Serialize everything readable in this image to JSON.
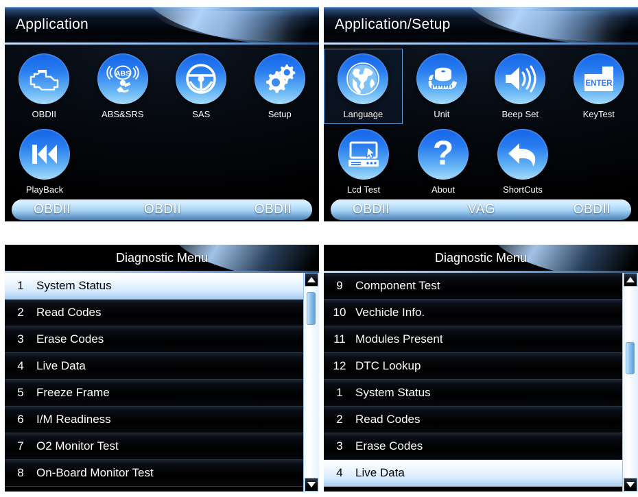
{
  "panels": {
    "application": {
      "title": "Application",
      "items": [
        {
          "label": "OBDII",
          "icon": "engine-icon"
        },
        {
          "label": "ABS&SRS",
          "icon": "abs-srs-icon"
        },
        {
          "label": "SAS",
          "icon": "steering-wheel-icon"
        },
        {
          "label": "Setup",
          "icon": "gears-icon"
        },
        {
          "label": "PlayBack",
          "icon": "rewind-icon"
        }
      ],
      "softkeys": [
        "OBDII",
        "OBDII",
        "OBDII"
      ]
    },
    "setup": {
      "title": "Application/Setup",
      "items": [
        {
          "label": "Language",
          "icon": "globe-icon",
          "selected": true
        },
        {
          "label": "Unit",
          "icon": "tape-measure-icon",
          "selected": false
        },
        {
          "label": "Beep Set",
          "icon": "speaker-icon",
          "selected": false
        },
        {
          "label": "KeyTest",
          "icon": "enter-key-icon",
          "selected": false
        },
        {
          "label": "Lcd Test",
          "icon": "monitor-cursor-icon",
          "selected": false
        },
        {
          "label": "About",
          "icon": "question-mark-icon",
          "selected": false
        },
        {
          "label": "ShortCuts",
          "icon": "back-arrow-icon",
          "selected": false
        }
      ],
      "softkeys": [
        "OBDII",
        "VAG",
        "OBDII"
      ]
    },
    "diagnostic_page1": {
      "title": "Diagnostic Menu",
      "rows": [
        {
          "num": "1",
          "label": "System  Status",
          "highlighted": true
        },
        {
          "num": "2",
          "label": "Read Codes",
          "highlighted": false
        },
        {
          "num": "3",
          "label": "Erase Codes",
          "highlighted": false
        },
        {
          "num": "4",
          "label": "Live Data",
          "highlighted": false
        },
        {
          "num": "5",
          "label": "Freeze Frame",
          "highlighted": false
        },
        {
          "num": "6",
          "label": "I/M Readiness",
          "highlighted": false
        },
        {
          "num": "7",
          "label": "O2 Monitor Test",
          "highlighted": false
        },
        {
          "num": "8",
          "label": "On-Board Monitor Test",
          "highlighted": false
        }
      ],
      "scroll": {
        "thumb_top_pct": 3,
        "thumb_height_pct": 17
      }
    },
    "diagnostic_page2": {
      "title": "Diagnostic Menu",
      "rows": [
        {
          "num": "9",
          "label": "Component Test",
          "highlighted": false
        },
        {
          "num": "10",
          "label": "Vechicle Info.",
          "highlighted": false
        },
        {
          "num": "11",
          "label": "Modules Present",
          "highlighted": false
        },
        {
          "num": "12",
          "label": " DTC Lookup",
          "highlighted": false
        },
        {
          "num": "1",
          "label": "System Status",
          "highlighted": false
        },
        {
          "num": "2",
          "label": "Read Codes",
          "highlighted": false
        },
        {
          "num": "3",
          "label": "Erase Codes",
          "highlighted": false
        },
        {
          "num": "4",
          "label": "Live Data",
          "highlighted": true
        }
      ],
      "scroll": {
        "thumb_top_pct": 29,
        "thumb_height_pct": 17
      }
    }
  },
  "colors": {
    "accent_blue": "#1464e8",
    "icon_light": "#a8dcfb",
    "highlight_row": "#d6eaff",
    "screen_black": "#000000",
    "softkey_bar": "#a8d4f5"
  }
}
